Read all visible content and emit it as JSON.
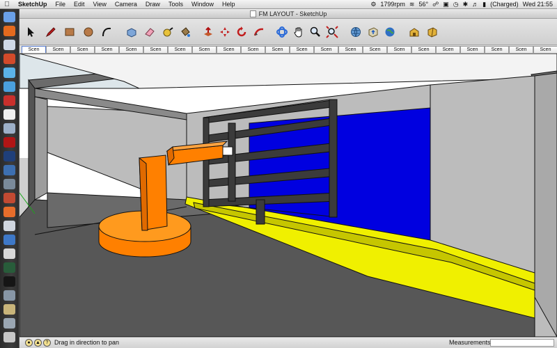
{
  "menubar": {
    "apple": "",
    "app_name": "SketchUp",
    "menus": [
      "File",
      "Edit",
      "View",
      "Camera",
      "Draw",
      "Tools",
      "Window",
      "Help"
    ],
    "status": {
      "fan": "1799rpm",
      "temperature": "56°",
      "battery": "(Charged)",
      "clock": "Wed 21:55"
    }
  },
  "window": {
    "title": "FM LAYOUT - SketchUp"
  },
  "toolbar": {
    "tools": [
      {
        "name": "select-tool",
        "icon": "arrow-icon"
      },
      {
        "name": "pencil-tool",
        "icon": "pencil-icon"
      },
      {
        "name": "rectangle-tool",
        "icon": "rectangle-icon"
      },
      {
        "name": "circle-tool",
        "icon": "circle-icon"
      },
      {
        "name": "arc-tool",
        "icon": "arc-icon"
      },
      {
        "name": "make-component-tool",
        "icon": "component-icon"
      },
      {
        "name": "eraser-tool",
        "icon": "eraser-icon"
      },
      {
        "name": "tape-measure-tool",
        "icon": "tape-icon"
      },
      {
        "name": "paint-bucket-tool",
        "icon": "bucket-icon"
      },
      {
        "name": "push-pull-tool",
        "icon": "pushpull-icon"
      },
      {
        "name": "move-tool",
        "icon": "move-icon"
      },
      {
        "name": "rotate-tool",
        "icon": "rotate-icon"
      },
      {
        "name": "follow-me-tool",
        "icon": "followme-icon"
      },
      {
        "name": "orbit-tool",
        "icon": "orbit-icon"
      },
      {
        "name": "pan-tool",
        "icon": "hand-icon"
      },
      {
        "name": "zoom-tool",
        "icon": "zoom-icon"
      },
      {
        "name": "zoom-extents-tool",
        "icon": "zoom-extents-icon"
      },
      {
        "name": "get-models-tool",
        "icon": "globe-icon"
      },
      {
        "name": "share-model-tool",
        "icon": "share-icon"
      },
      {
        "name": "google-earth-tool",
        "icon": "earth-icon"
      },
      {
        "name": "warehouse-tool",
        "icon": "warehouse-icon"
      },
      {
        "name": "extension-tool",
        "icon": "extension-icon"
      }
    ]
  },
  "scenes": {
    "tabs": [
      "Scen",
      "Scen",
      "Scen",
      "Scen",
      "Scen",
      "Scen",
      "Scen",
      "Scen",
      "Scen",
      "Scen",
      "Scen",
      "Scen",
      "Scen",
      "Scen",
      "Scen",
      "Scen",
      "Scen",
      "Scen",
      "Scen",
      "Scen",
      "Scen",
      "Scen"
    ],
    "active_index": 0
  },
  "statusbar": {
    "hint": "Drag in direction to pan",
    "measurements_label": "Measurements",
    "measurements_value": ""
  },
  "colors": {
    "robot": "#ff8000",
    "wall_panel": "#0000e0",
    "track": "#f0f000",
    "floor": "#565656",
    "rack": "#3b3b3b",
    "wall": "#b8b8b8"
  }
}
